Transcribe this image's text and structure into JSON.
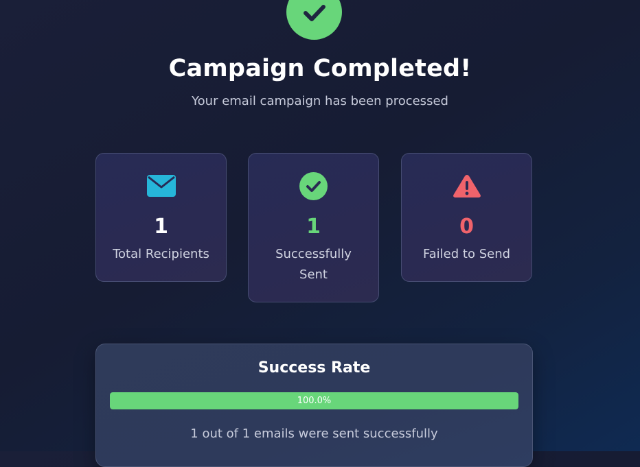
{
  "header": {
    "title": "Campaign Completed!",
    "subtitle": "Your email campaign has been processed",
    "status_icon": "check-circle-icon"
  },
  "stats": [
    {
      "icon": "envelope-icon",
      "value": "1",
      "label": "Total Recipients",
      "color": "#ffffff",
      "icon_color": "#26b6d9"
    },
    {
      "icon": "check-circle-icon",
      "value": "1",
      "label": "Successfully Sent",
      "color": "#68d67a",
      "icon_color": "#68d67a"
    },
    {
      "icon": "warning-icon",
      "value": "0",
      "label": "Failed to Send",
      "color": "#f0636b",
      "icon_color": "#f0636b"
    }
  ],
  "success_rate": {
    "title": "Success Rate",
    "progress": 1.0,
    "progress_label": "100.0%",
    "summary": "1 out of 1 emails were sent successfully",
    "bar_color": "#68d67a"
  },
  "colors": {
    "success": "#68d67a",
    "danger": "#f0636b",
    "info": "#26b6d9",
    "background": "#161c33"
  }
}
